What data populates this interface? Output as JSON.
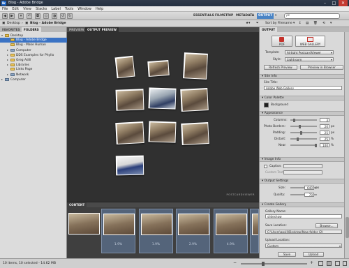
{
  "window": {
    "title": "Blog - Adobe Bridge",
    "min": "–",
    "max": "□",
    "close": "✕"
  },
  "menu": [
    "File",
    "Edit",
    "View",
    "Stacks",
    "Label",
    "Tools",
    "Window",
    "Help"
  ],
  "workspaces": [
    "ESSENTIALS",
    "FILMSTRIP",
    "METADATA",
    "OUTPUT"
  ],
  "workspace_active": "OUTPUT",
  "search": {
    "placeholder": "ρ▾"
  },
  "sort": {
    "label": "Sort by Filename",
    "arrow": "▾"
  },
  "path": {
    "root": "Desktop",
    "folder": "Blog - Adobe Bridge"
  },
  "left": {
    "tabs": [
      "FAVORITES",
      "FOLDERS"
    ],
    "tree": [
      {
        "label": "Desktop",
        "sel": false
      },
      {
        "label": "Blog - Adobe Bridge",
        "sel": true
      },
      {
        "label": "Blog - Make Human",
        "sel": false
      },
      {
        "label": "Computer",
        "sel": false
      },
      {
        "label": "DDS Examples for Phyllo",
        "sel": false
      },
      {
        "label": "Greg Adill",
        "sel": false
      },
      {
        "label": "Libraries",
        "sel": false
      },
      {
        "label": "Links Page",
        "sel": false
      },
      {
        "label": "Network",
        "sel": false
      },
      {
        "label": "Computer",
        "sel": false
      }
    ]
  },
  "preview": {
    "tabs": [
      "PREVIEW",
      "OUTPUT PREVIEW"
    ],
    "viewer": "POSTCARDVIEWER"
  },
  "content": {
    "tab": "CONTENT",
    "thumbs": [
      "1.9%",
      "1.9%",
      "2.9%",
      "4.9%",
      "1.9%"
    ]
  },
  "output": {
    "tab": "OUTPUT",
    "pdf": "PDF",
    "web": "WEB GALLERY",
    "template_label": "Template:",
    "template": "Airtight PostcardViewer",
    "style_label": "Style:",
    "style": "Lightroom",
    "refresh": "Refresh Preview",
    "preview_browser": "Preview in Browser",
    "site_info": "Site Info",
    "site_title_label": "Site Title:",
    "site_title": "Adobe Web Gallery",
    "color_palette": "Color Palette",
    "background": "Background",
    "appearance": "Appearance",
    "columns_label": "Columns:",
    "columns": "3",
    "borders_label": "Photo Borders:",
    "borders": "20",
    "borders_unit": "px",
    "padding_label": "Padding:",
    "padding": "25",
    "padding_unit": "px",
    "distant_label": "Distant:",
    "distant": "25",
    "distant_unit": "%",
    "near_label": "Near:",
    "near": "100",
    "near_unit": "%",
    "image_info": "Image Info",
    "caption_label": "Caption:",
    "custom_text_label": "Custom Text:",
    "output_settings": "Output Settings",
    "size_label": "Size:",
    "size": "640",
    "size_unit": "px",
    "quality_label": "Quality:",
    "quality": "70",
    "create_gallery": "Create Gallery",
    "gallery_name_label": "Gallery Name:",
    "gallery_name": "slideshow",
    "save_location_label": "Save Location:",
    "browse": "Browse...",
    "save_path": "C:\\Users\\gosill\\Desktop\\New folder (2)",
    "upload_location_label": "Upload Location:",
    "upload": "Custom",
    "save_btn": "Save",
    "upload_btn": "Upload",
    "colors": {
      "accent": "#4a84c5",
      "selected": "#3b73c4"
    }
  },
  "status": {
    "text": "10 items, 10 selected - 14.62 MB"
  }
}
